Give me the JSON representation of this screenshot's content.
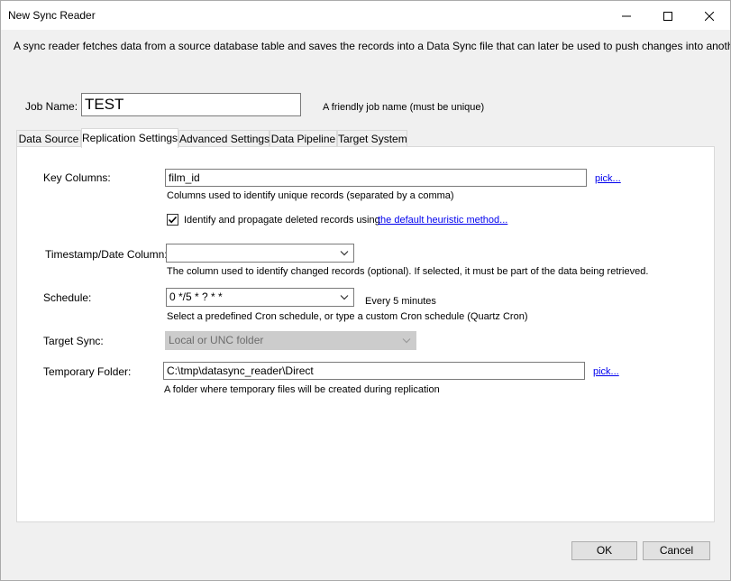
{
  "window": {
    "title": "New Sync Reader"
  },
  "description": "A sync reader fetches data from a source database table and saves the records into a Data Sync file that can later be used to push changes into another database.",
  "job": {
    "label": "Job Name:",
    "value": "TEST",
    "hint": "A friendly job name (must be unique)"
  },
  "tabs": [
    {
      "label": "Data Source",
      "active": false
    },
    {
      "label": "Replication Settings",
      "active": true
    },
    {
      "label": "Advanced Settings",
      "active": false
    },
    {
      "label": "Data Pipeline",
      "active": false
    },
    {
      "label": "Target System",
      "active": false
    }
  ],
  "replication": {
    "key_columns": {
      "label": "Key Columns:",
      "value": "film_id",
      "pick": "pick...",
      "hint": "Columns used to identify unique records (separated by a comma)"
    },
    "deleted": {
      "checked": true,
      "label": "Identify and propagate deleted records using",
      "link": "the default heuristic method..."
    },
    "timestamp": {
      "label": "Timestamp/Date Column:",
      "value": "",
      "hint": "The column used to identify changed records (optional). If selected, it must be part of the data being retrieved."
    },
    "schedule": {
      "label": "Schedule:",
      "value": "0 */5 * ? * *",
      "summary": "Every 5 minutes",
      "hint": "Select a predefined Cron schedule, or type a custom Cron schedule (Quartz Cron)"
    },
    "target_sync": {
      "label": "Target Sync:",
      "value": "Local or UNC folder"
    },
    "temp_folder": {
      "label": "Temporary Folder:",
      "value": "C:\\tmp\\datasync_reader\\Direct",
      "pick": "pick...",
      "hint": "A folder where temporary files will be created during replication"
    }
  },
  "buttons": {
    "ok": "OK",
    "cancel": "Cancel"
  }
}
